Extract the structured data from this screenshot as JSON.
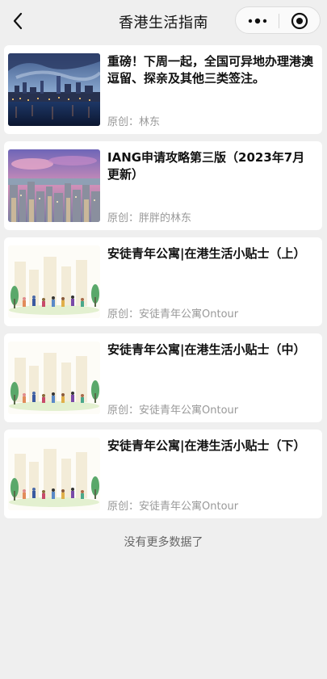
{
  "nav": {
    "title": "香港生活指南",
    "back_icon": "chevron-left-icon",
    "more_icon": "more-dots-icon",
    "close_icon": "target-circle-icon"
  },
  "articles": [
    {
      "title": "重磅！下周一起，全国可异地办理港澳逗留、探亲及其他三类签注。",
      "meta": "原创：林东",
      "image": "hong-kong-harbour-night"
    },
    {
      "title": "IANG申请攻略第三版（2023年7月更新）",
      "meta": "原创：胖胖的林东",
      "image": "hong-kong-skyline-dusk"
    },
    {
      "title": "安徒青年公寓|在港生活小贴士（上）",
      "meta": "原创：安徒青年公寓Ontour",
      "image": "city-crowd-illustration"
    },
    {
      "title": "安徒青年公寓|在港生活小贴士（中）",
      "meta": "原创：安徒青年公寓Ontour",
      "image": "city-crowd-illustration"
    },
    {
      "title": "安徒青年公寓|在港生活小贴士（下）",
      "meta": "原创：安徒青年公寓Ontour",
      "image": "city-crowd-illustration"
    }
  ],
  "footer": "没有更多数据了"
}
